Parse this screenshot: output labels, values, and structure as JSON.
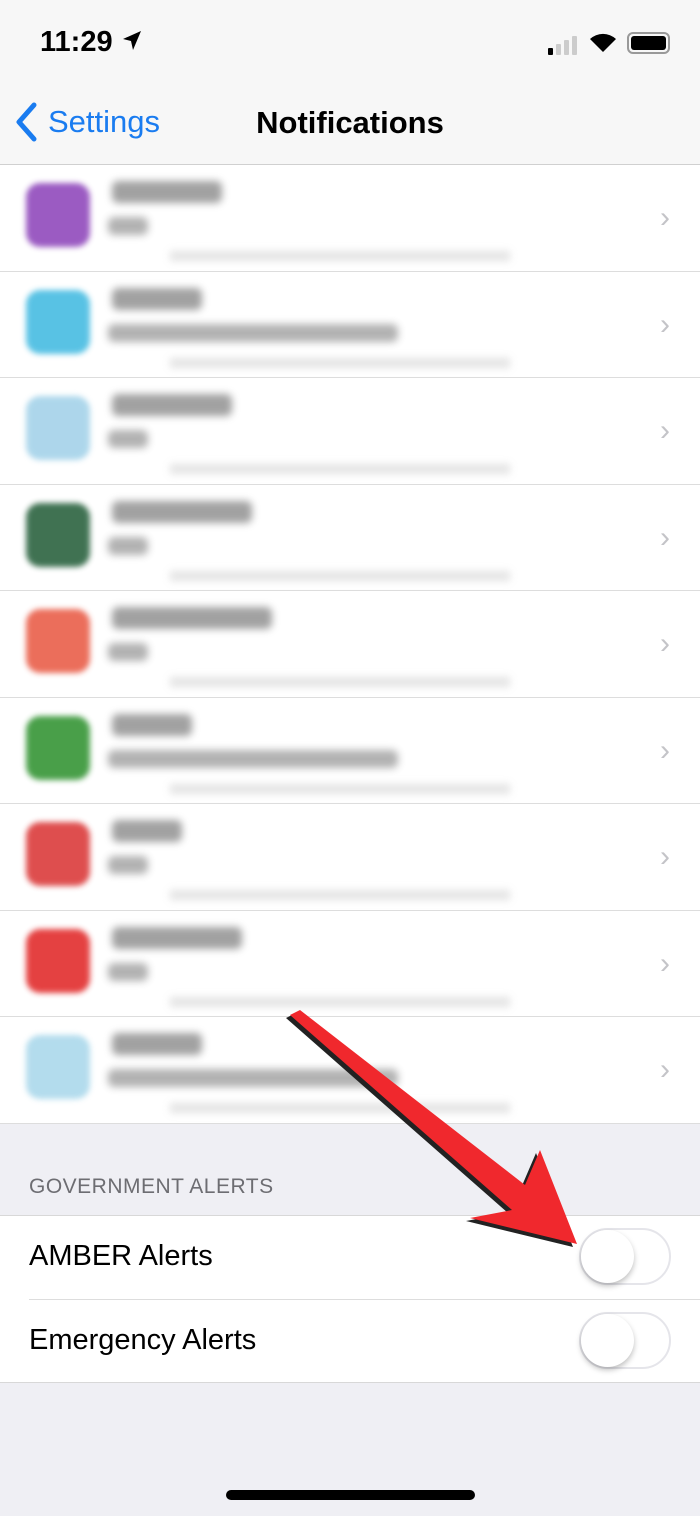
{
  "status_bar": {
    "time": "11:29",
    "icons": [
      "location-arrow-icon",
      "cellular-signal-icon",
      "wifi-icon",
      "battery-icon"
    ]
  },
  "nav": {
    "back_label": "Settings",
    "title": "Notifications"
  },
  "app_rows": [
    {
      "icon_color": "#8a3fb8"
    },
    {
      "icon_color": "#3cb8e0"
    },
    {
      "icon_color": "#9fd0e8"
    },
    {
      "icon_color": "#1f5a35"
    },
    {
      "icon_color": "#e8553f"
    },
    {
      "icon_color": "#2a8f2a"
    },
    {
      "icon_color": "#d93030"
    },
    {
      "icon_color": "#e02020"
    },
    {
      "icon_color": "#a6d6ea"
    }
  ],
  "government_alerts": {
    "header": "GOVERNMENT ALERTS",
    "items": [
      {
        "label": "AMBER Alerts",
        "on": false
      },
      {
        "label": "Emergency Alerts",
        "on": false
      }
    ]
  },
  "annotation": {
    "arrow_color": "#f0282d"
  }
}
